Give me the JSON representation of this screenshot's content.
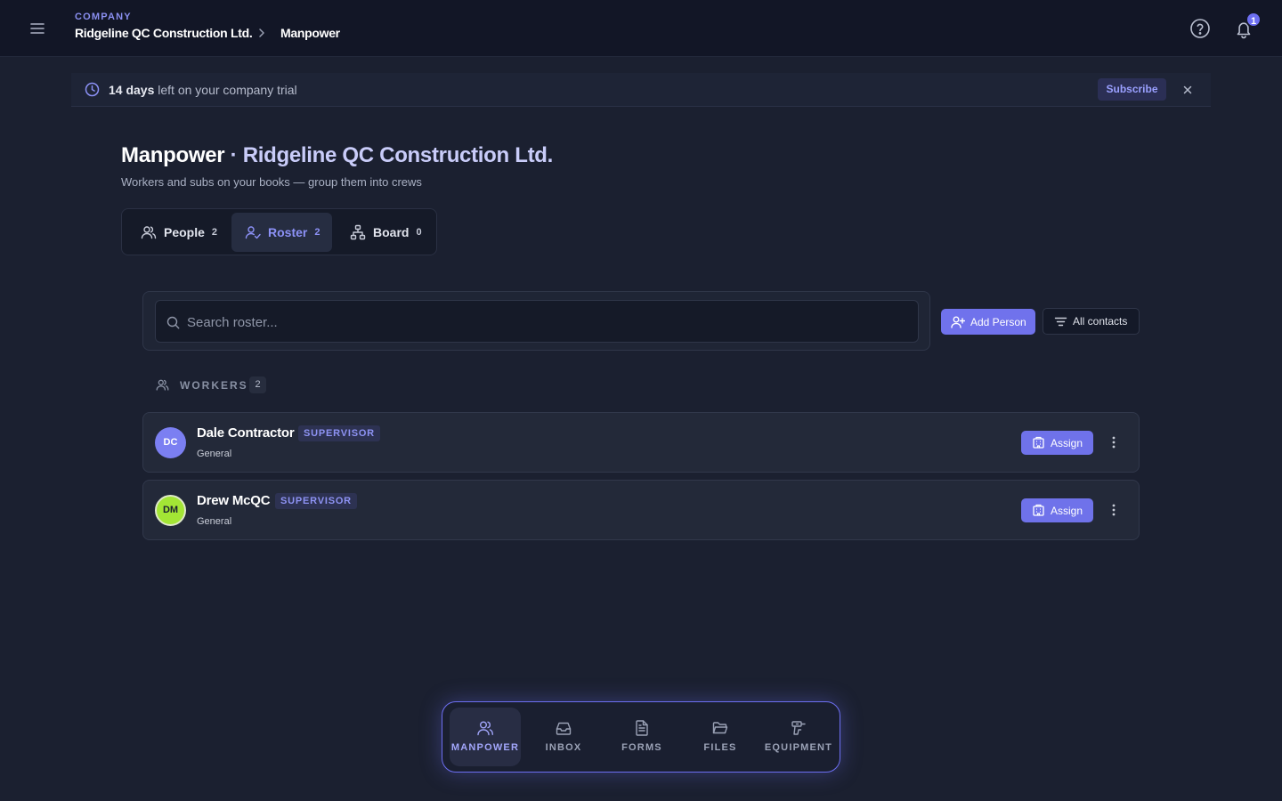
{
  "topbar": {
    "section_label": "COMPANY",
    "company_name": "Ridgeline QC Construction Ltd.",
    "current_page": "Manpower",
    "notification_count": "1"
  },
  "trial": {
    "days": "14 days",
    "text": " left on your company trial",
    "subscribe_label": "Subscribe"
  },
  "header": {
    "title": "Manpower",
    "separator": " · ",
    "company": "Ridgeline QC Construction Ltd.",
    "subtitle": "Workers and subs on your books — group them into crews"
  },
  "tabs": [
    {
      "label": "People",
      "count": "2",
      "icon": "people-icon",
      "active": false
    },
    {
      "label": "Roster",
      "count": "2",
      "icon": "roster-icon",
      "active": true
    },
    {
      "label": "Board",
      "count": "0",
      "icon": "org-chart-icon",
      "active": false
    }
  ],
  "search": {
    "placeholder": "Search roster...",
    "value": ""
  },
  "toolbar": {
    "add_person_label": "Add Person",
    "all_contacts_label": "All contacts"
  },
  "workers_section": {
    "label": "WORKERS",
    "count": "2"
  },
  "workers": [
    {
      "initials": "DC",
      "name": "Dale Contractor",
      "role": "SUPERVISOR",
      "trade": "General",
      "avatar_color": "#7b7ff2",
      "avatar_text_color": "#ffffff"
    },
    {
      "initials": "DM",
      "name": "Drew McQC",
      "role": "SUPERVISOR",
      "trade": "General",
      "avatar_color": "#a3e635",
      "avatar_text_color": "#1b2030"
    }
  ],
  "assign_label": "Assign",
  "bottom_nav": [
    {
      "label": "MANPOWER",
      "icon": "people-icon",
      "active": true
    },
    {
      "label": "INBOX",
      "icon": "inbox-icon",
      "active": false
    },
    {
      "label": "FORMS",
      "icon": "document-icon",
      "active": false
    },
    {
      "label": "FILES",
      "icon": "folder-icon",
      "active": false
    },
    {
      "label": "EQUIPMENT",
      "icon": "drill-icon",
      "active": false
    }
  ],
  "colors": {
    "background": "#1b2030",
    "accent": "#6d6ff2",
    "topbar": "#121626"
  }
}
